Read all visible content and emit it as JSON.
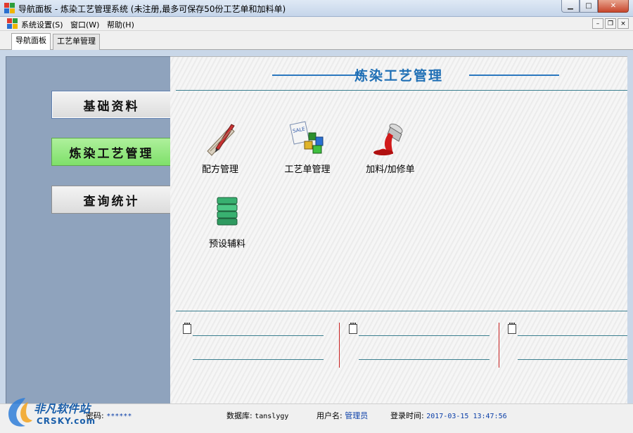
{
  "window": {
    "title": "导航面板 - 炼染工艺管理系统 (未注册,最多可保存50份工艺单和加料单)",
    "icon": "app-icon"
  },
  "menu": {
    "items": [
      "系统设置(S)",
      "窗口(W)",
      "帮助(H)"
    ]
  },
  "tabs": [
    "导航面板",
    "工艺单管理"
  ],
  "nav": {
    "buttons": [
      "基础资料",
      "炼染工艺管理",
      "查询统计"
    ],
    "active_index": 1
  },
  "section": {
    "title": "炼染工艺管理"
  },
  "functions": [
    {
      "label": "配方管理",
      "icon": "ruler-pencil-icon"
    },
    {
      "label": "工艺单管理",
      "icon": "sale-cubes-icon"
    },
    {
      "label": "加料/加修单",
      "icon": "paint-can-icon"
    },
    {
      "label": "预设辅料",
      "icon": "stack-layers-icon"
    }
  ],
  "status": {
    "password_label": "密码:",
    "password_value": "******",
    "db_label": "数据库:",
    "db_value": "tanslygy",
    "user_label": "用户名:",
    "user_value": "管理员",
    "login_label": "登录时间:",
    "login_value": "2017-03-15 13:47:56"
  },
  "watermark": {
    "text": "非凡软件站",
    "sub": "CRSKY.com"
  },
  "colors": {
    "accent": "#1f6fb5",
    "nav_active": "#7fe06a",
    "left_panel": "#8fa3bd"
  }
}
